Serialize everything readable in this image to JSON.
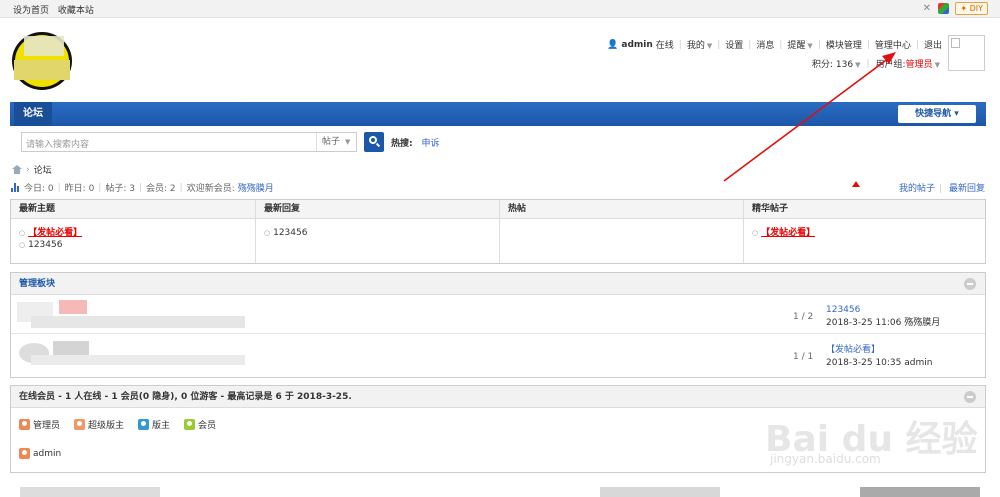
{
  "topbar": {
    "links": [
      "设为首页",
      "收藏本站"
    ],
    "diy": "✦ DIY"
  },
  "header": {
    "username": "admin",
    "status": "在线",
    "menu": [
      "我的",
      "设置",
      "消息",
      "提醒",
      "模块管理",
      "管理中心",
      "退出"
    ],
    "points_label": "积分: 136",
    "group_label": "用户组:",
    "group_value": "管理员"
  },
  "nav": {
    "tab": "论坛",
    "quick": "快捷导航 ▾"
  },
  "search": {
    "placeholder": "请输入搜索内容",
    "type": "帖子",
    "hot_label": "热搜:",
    "hot_items": [
      "申诉"
    ]
  },
  "breadcrumb": {
    "current": "论坛"
  },
  "stats": {
    "today": "今日: 0",
    "yesterday": "昨日: 0",
    "posts": "帖子: 3",
    "members": "会员: 2",
    "welcome": "欢迎新会员:",
    "newest": "殇殇膜月"
  },
  "right_links": [
    "我的帖子",
    "最新回复"
  ],
  "grid": {
    "headers": [
      "最新主题",
      "最新回复",
      "热帖",
      "精华帖子"
    ],
    "col1": [
      "【发帖必看】",
      "123456"
    ],
    "col2": [
      "123456"
    ],
    "col4": [
      "【发帖必看】"
    ]
  },
  "boards": {
    "title": "管理板块",
    "rows": [
      {
        "count": "1 / 2",
        "last_title": "123456",
        "last_meta": "2018-3-25 11:06 殇殇膜月"
      },
      {
        "count": "1 / 1",
        "last_title": "【发帖必看】",
        "last_meta": "2018-3-25 10:35 admin"
      }
    ]
  },
  "online": {
    "title": "在线会员 - 1 人在线 - 1 会员(0 隐身), 0 位游客 - 最高记录是 6 于 2018-3-25.",
    "legend": [
      "管理员",
      "超级版主",
      "版主",
      "会员"
    ],
    "users": [
      "admin"
    ]
  },
  "watermark": {
    "main": "Bai du 经验",
    "sub": "jingyan.baidu.com"
  },
  "colors": {
    "nav": "#1d57a8",
    "accent_red": "#e00",
    "link": "#36c"
  }
}
